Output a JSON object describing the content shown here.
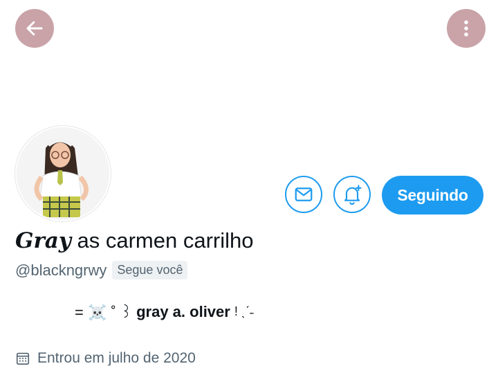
{
  "header": {
    "back_icon": "arrow-left-icon",
    "more_icon": "more-vertical-icon"
  },
  "profile": {
    "display_name_styled": "Gray",
    "display_name_rest": " as carmen carrilho",
    "handle": "@blackngrwy",
    "follows_you_label": "Segue você",
    "bio": {
      "prefix": "= ☠️ ˚ ꒱",
      "name": "gray a. oliver",
      "suffix": "! ˎˊ˗"
    },
    "joined_label": "Entrou em julho de 2020"
  },
  "actions": {
    "mail_icon": "mail-icon",
    "notify_icon": "bell-plus-icon",
    "follow_label": "Seguindo"
  },
  "colors": {
    "accent": "#1d9bf0",
    "header_button": "#c9a3a8",
    "secondary_text": "#536471"
  }
}
